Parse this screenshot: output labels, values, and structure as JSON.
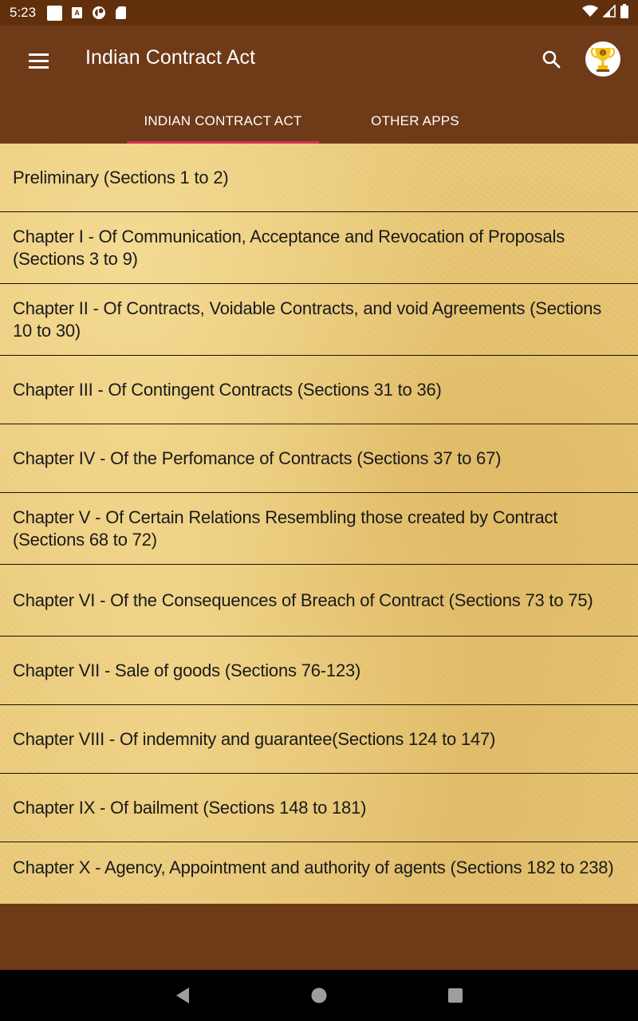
{
  "status_bar": {
    "time": "5:23",
    "left_icons": [
      "notification-square-icon",
      "accessibility-a-icon",
      "data-saver-icon",
      "sd-card-icon"
    ],
    "right_icons": [
      "wifi-icon",
      "cellular-signal-icon",
      "battery-icon"
    ]
  },
  "app_bar": {
    "title": "Indian Contract Act",
    "menu_icon": "hamburger-menu-icon",
    "search_icon": "search-icon",
    "trophy_icon": "trophy-icon"
  },
  "tabs": [
    {
      "label": "INDIAN CONTRACT ACT",
      "selected": true
    },
    {
      "label": "OTHER APPS",
      "selected": false
    }
  ],
  "colors": {
    "app_bar": "#6f3a18",
    "status_bar": "#612f0c",
    "tab_indicator": "#d6305a",
    "list_background": "#e9c97a",
    "divider": "#1a1208",
    "text": "#1a1a1a"
  },
  "chapters": [
    {
      "label": "Preliminary (Sections 1 to 2)"
    },
    {
      "label": "Chapter I - Of Communication, Acceptance and Revocation of Proposals (Sections 3 to 9)"
    },
    {
      "label": "Chapter II - Of Contracts, Voidable Contracts, and void Agreements (Sections 10 to 30)"
    },
    {
      "label": "Chapter III - Of Contingent Contracts (Sections 31 to 36)"
    },
    {
      "label": "Chapter IV - Of the Perfomance of Contracts (Sections 37 to 67)"
    },
    {
      "label": "Chapter V - Of Certain Relations Resembling those created by Contract (Sections 68 to 72)"
    },
    {
      "label": "Chapter VI - Of the Consequences of Breach of Contract (Sections 73 to 75)"
    },
    {
      "label": "Chapter VII - Sale of goods (Sections 76-123)"
    },
    {
      "label": "Chapter VIII - Of indemnity and guarantee(Sections 124 to 147)"
    },
    {
      "label": "Chapter IX - Of bailment (Sections 148 to 181)"
    },
    {
      "label": "Chapter X - Agency, Appointment and authority of agents (Sections 182 to 238)"
    }
  ],
  "nav_bar": {
    "back_icon": "back-triangle-icon",
    "home_icon": "home-circle-icon",
    "recents_icon": "recents-square-icon"
  }
}
